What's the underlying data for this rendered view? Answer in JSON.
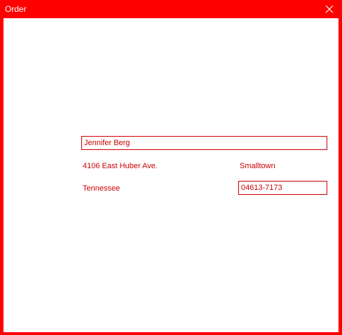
{
  "window": {
    "title": "Order",
    "close_icon": "close-icon",
    "accent_color": "#ff0000"
  },
  "form": {
    "name_value": "Jennifer Berg",
    "street_value": "4106 East Huber Ave.",
    "city_value": "Smalltown",
    "state_value": "Tennessee",
    "zip_value": "04613-7173"
  }
}
